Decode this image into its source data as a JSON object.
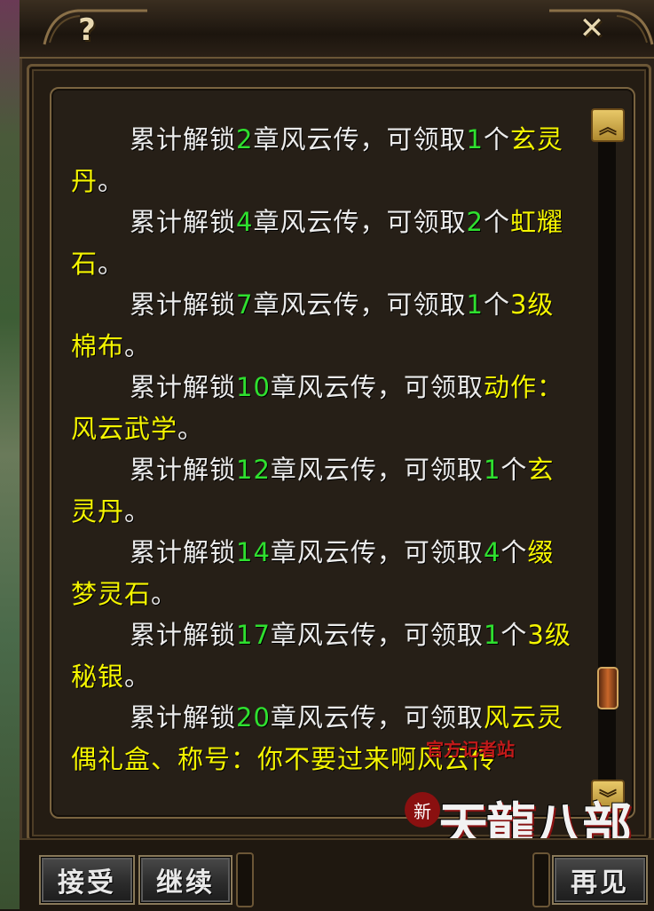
{
  "window": {
    "help_label": "?",
    "close_label": "✕"
  },
  "content": {
    "paragraphs": [
      [
        {
          "t": "累计解锁",
          "c": "text"
        },
        {
          "t": "2",
          "c": "num"
        },
        {
          "t": "章风云传，可领取",
          "c": "text"
        },
        {
          "t": "1",
          "c": "num"
        },
        {
          "t": "个",
          "c": "text"
        },
        {
          "t": "玄灵丹",
          "c": "item"
        },
        {
          "t": "。",
          "c": "text"
        }
      ],
      [
        {
          "t": "累计解锁",
          "c": "text"
        },
        {
          "t": "4",
          "c": "num"
        },
        {
          "t": "章风云传，可领取",
          "c": "text"
        },
        {
          "t": "2",
          "c": "num"
        },
        {
          "t": "个",
          "c": "text"
        },
        {
          "t": "虹耀石",
          "c": "item"
        },
        {
          "t": "。",
          "c": "text"
        }
      ],
      [
        {
          "t": "累计解锁",
          "c": "text"
        },
        {
          "t": "7",
          "c": "num"
        },
        {
          "t": "章风云传，可领取",
          "c": "text"
        },
        {
          "t": "1",
          "c": "num"
        },
        {
          "t": "个",
          "c": "text"
        },
        {
          "t": "3级棉布",
          "c": "item"
        },
        {
          "t": "。",
          "c": "text"
        }
      ],
      [
        {
          "t": "累计解锁",
          "c": "text"
        },
        {
          "t": "10",
          "c": "num"
        },
        {
          "t": "章风云传，可领取",
          "c": "text"
        },
        {
          "t": "动作：风云武学",
          "c": "item"
        },
        {
          "t": "。",
          "c": "text"
        }
      ],
      [
        {
          "t": "累计解锁",
          "c": "text"
        },
        {
          "t": "12",
          "c": "num"
        },
        {
          "t": "章风云传，可领取",
          "c": "text"
        },
        {
          "t": "1",
          "c": "num"
        },
        {
          "t": "个",
          "c": "text"
        },
        {
          "t": "玄灵丹",
          "c": "item"
        },
        {
          "t": "。",
          "c": "text"
        }
      ],
      [
        {
          "t": "累计解锁",
          "c": "text"
        },
        {
          "t": "14",
          "c": "num"
        },
        {
          "t": "章风云传，可领取",
          "c": "text"
        },
        {
          "t": "4",
          "c": "num"
        },
        {
          "t": "个",
          "c": "text"
        },
        {
          "t": "缀梦灵石",
          "c": "item"
        },
        {
          "t": "。",
          "c": "text"
        }
      ],
      [
        {
          "t": "累计解锁",
          "c": "text"
        },
        {
          "t": "17",
          "c": "num"
        },
        {
          "t": "章风云传，可领取",
          "c": "text"
        },
        {
          "t": "1",
          "c": "num"
        },
        {
          "t": "个",
          "c": "text"
        },
        {
          "t": "3级秘银",
          "c": "item"
        },
        {
          "t": "。",
          "c": "text"
        }
      ],
      [
        {
          "t": "累计解锁",
          "c": "text"
        },
        {
          "t": "20",
          "c": "num"
        },
        {
          "t": "章风云传，可领取",
          "c": "text"
        },
        {
          "t": "风云灵偶礼盒、称号：你不要过来啊风云传",
          "c": "item"
        }
      ]
    ]
  },
  "scrollbar": {
    "up_icon": "︽",
    "down_icon": "︾",
    "scroll_position": 0.88
  },
  "buttons": {
    "accept": "接受",
    "continue": "继续",
    "goodbye": "再见"
  },
  "watermark": {
    "site": "官方记者站",
    "badge": "新",
    "logo": "天龍八部"
  },
  "colors": {
    "highlight_number": "#2fe02f",
    "highlight_item": "#f5f500",
    "body_text": "#ececec"
  }
}
